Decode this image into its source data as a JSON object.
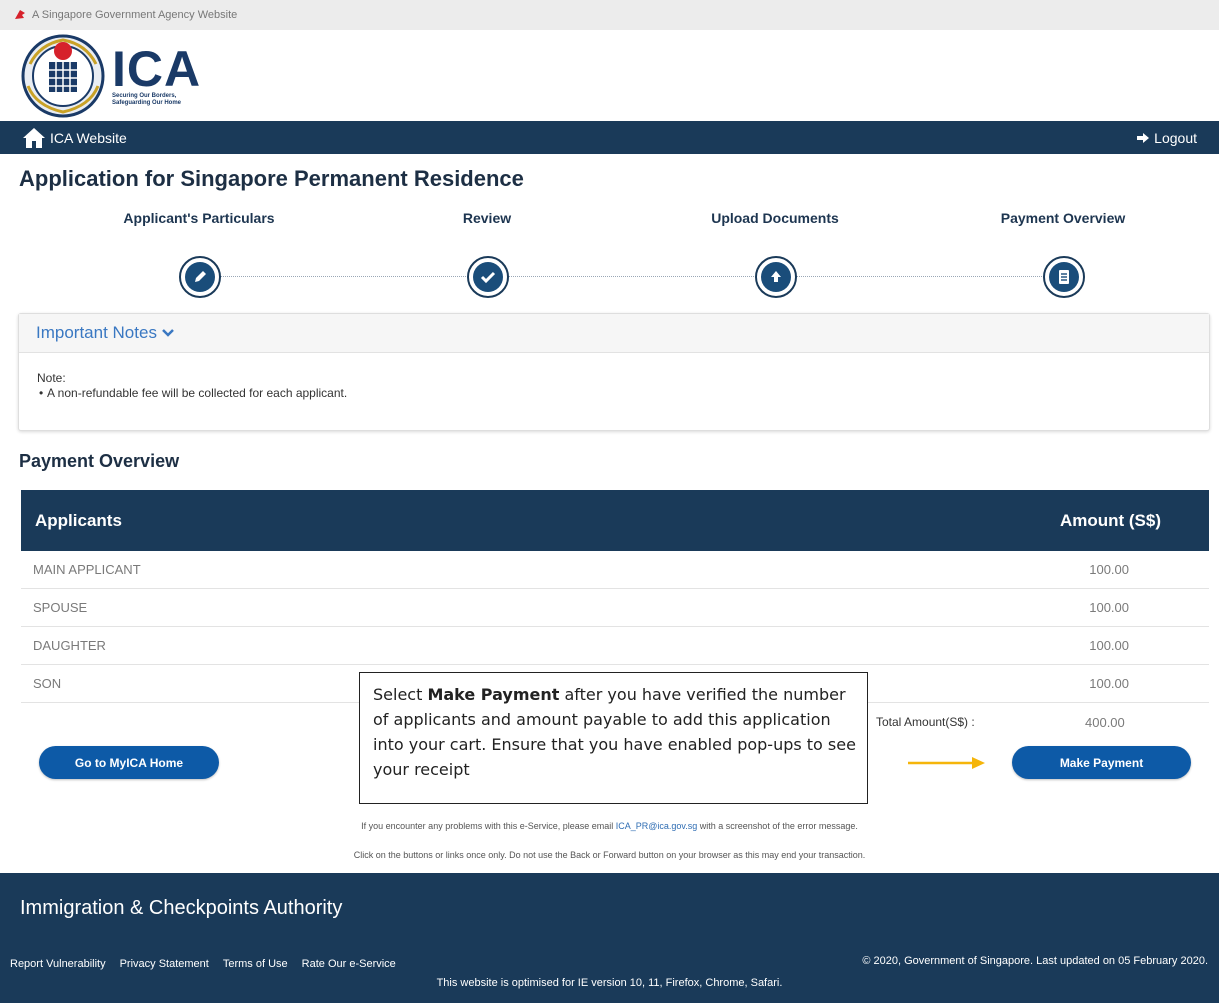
{
  "gov_bar": {
    "text": "A Singapore Government Agency Website"
  },
  "logo": {
    "name": "ICA",
    "tagline_1": "Securing Our Borders,",
    "tagline_2": "Safeguarding Our Home"
  },
  "nav": {
    "home_label": "ICA Website",
    "logout_label": "Logout"
  },
  "page": {
    "title": "Application for Singapore Permanent Residence"
  },
  "steps": [
    {
      "label": "Applicant's Particulars",
      "icon": "pencil-badge-icon"
    },
    {
      "label": "Review",
      "icon": "check-badge-icon"
    },
    {
      "label": "Upload Documents",
      "icon": "upload-badge-icon"
    },
    {
      "label": "Payment Overview",
      "icon": "document-icon"
    }
  ],
  "notes": {
    "header": "Important Notes",
    "note_label": "Note:",
    "items": [
      "A non-refundable fee will be collected for each applicant."
    ]
  },
  "payment": {
    "title": "Payment Overview",
    "columns": [
      "Applicants",
      "Amount (S$)"
    ],
    "rows": [
      {
        "applicant": "MAIN APPLICANT",
        "amount": "100.00"
      },
      {
        "applicant": "SPOUSE",
        "amount": "100.00"
      },
      {
        "applicant": "DAUGHTER",
        "amount": "100.00"
      },
      {
        "applicant": "SON",
        "amount": "100.00"
      }
    ],
    "total_label": "Total Amount(S$) :",
    "total_value": "400.00"
  },
  "buttons": {
    "home": "Go to MyICA Home",
    "pay": "Make Payment"
  },
  "callout": {
    "prefix": "Select ",
    "bold": "Make Payment",
    "suffix": " after you have verified the number of applicants and amount payable to add this application into your cart. Ensure that you have enabled pop-ups to see your receipt"
  },
  "info": {
    "line1_pre": "If you encounter any problems with this e-Service, please email ",
    "line1_email": "ICA_PR@ica.gov.sg",
    "line1_post": " with a screenshot of the error message.",
    "line2": "Click on the buttons or links once only. Do not use the Back or Forward button on your browser as this may end your transaction."
  },
  "footer": {
    "title": "Immigration & Checkpoints Authority",
    "links": [
      "Report Vulnerability",
      "Privacy Statement",
      "Terms of Use",
      "Rate Our e-Service"
    ],
    "copyright": "© 2020, Government of Singapore. Last updated on 05 February 2020.",
    "optimised": "This website is optimised for IE version 10, 11, Firefox, Chrome, Safari."
  },
  "colors": {
    "navy": "#1a3a59",
    "button_blue": "#0d5aa7",
    "link_blue": "#3a78c2",
    "arrow_yellow": "#f5b50a"
  }
}
